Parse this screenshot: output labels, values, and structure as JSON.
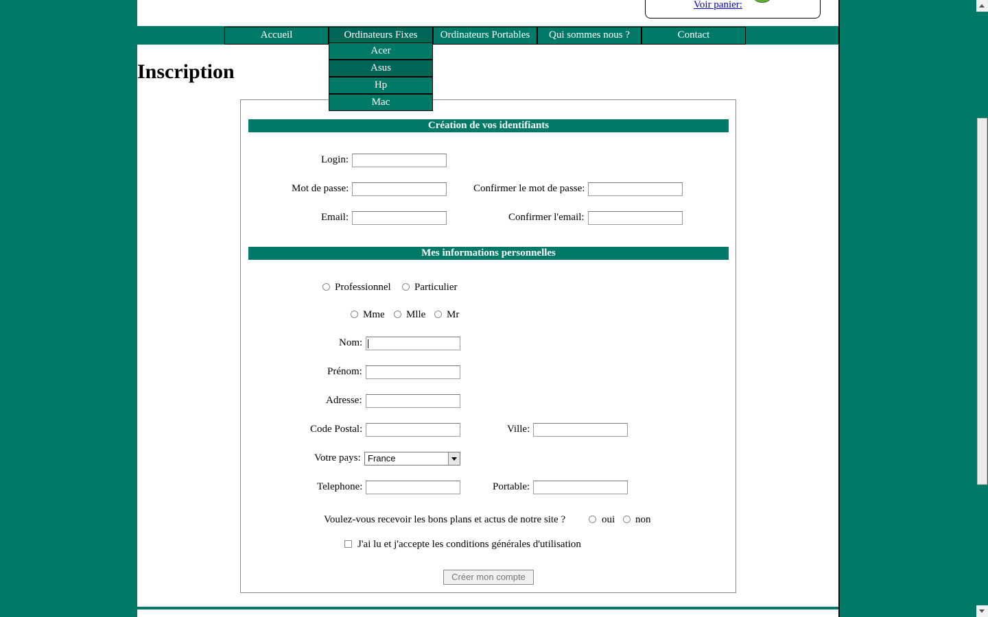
{
  "header": {
    "cart_link": "Voir panier:"
  },
  "nav": {
    "items": [
      "Accueil",
      "Ordinateurs Fixes",
      "Ordinateurs Portables",
      "Qui sommes nous ?",
      "Contact"
    ],
    "submenu": [
      "Acer",
      "Asus",
      "Hp",
      "Mac"
    ]
  },
  "page": {
    "title": "Inscription"
  },
  "form": {
    "section1": "Création de vos identifiants",
    "login_label": "Login:",
    "password_label": "Mot de passe:",
    "confirm_password_label": "Confirmer le mot de passe:",
    "email_label": "Email:",
    "confirm_email_label": "Confirmer l'email:",
    "section2": "Mes informations personnelles",
    "type_pro": "Professionnel",
    "type_part": "Particulier",
    "civ_mme": "Mme",
    "civ_mlle": "Mlle",
    "civ_mr": "Mr",
    "nom_label": "Nom:",
    "prenom_label": "Prénom:",
    "adresse_label": "Adresse:",
    "cp_label": "Code Postal:",
    "ville_label": "Ville:",
    "pays_label": "Votre pays:",
    "pays_value": "France",
    "tel_label": "Telephone:",
    "portable_label": "Portable:",
    "newsletter_question": "Voulez-vous recevoir les bons plans et actus de notre site ?",
    "newsletter_oui": "oui",
    "newsletter_non": "non",
    "cgu_label": "J'ai lu et j'accepte les conditions générales d'utilisation",
    "submit": "Créer mon compte"
  },
  "colors": {
    "brand": "#007a67",
    "link": "#0000cc"
  }
}
